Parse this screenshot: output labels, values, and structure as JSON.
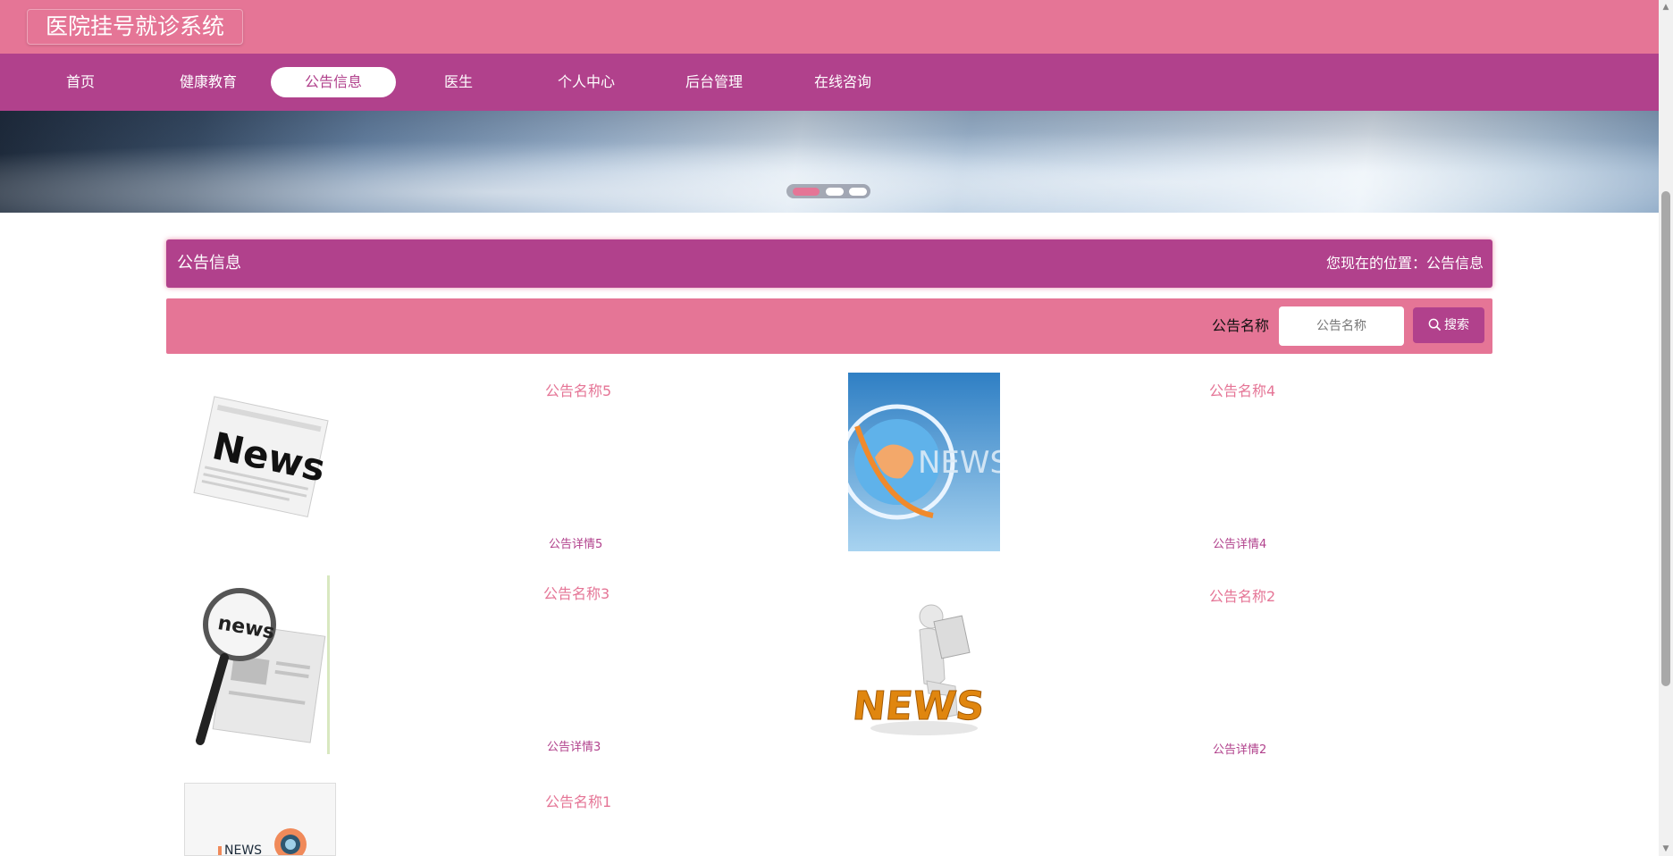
{
  "header": {
    "title": "医院挂号就诊系统"
  },
  "nav": {
    "items": [
      {
        "label": "首页"
      },
      {
        "label": "健康教育"
      },
      {
        "label": "公告信息"
      },
      {
        "label": "医生"
      },
      {
        "label": "个人中心"
      },
      {
        "label": "后台管理"
      },
      {
        "label": "在线咨询"
      }
    ],
    "active_index": 2
  },
  "banner": {
    "slide_count": 3,
    "active_slide": 1
  },
  "section": {
    "title": "公告信息",
    "breadcrumb": "您现在的位置：公告信息"
  },
  "search": {
    "label": "公告名称",
    "placeholder": "公告名称",
    "button_label": "搜索"
  },
  "notices": [
    {
      "name": "公告名称5",
      "detail": "公告详情5",
      "image": "newspaper-news-icon"
    },
    {
      "name": "公告名称4",
      "detail": "公告详情4",
      "image": "globe-news-icon"
    },
    {
      "name": "公告名称3",
      "detail": "公告详情3",
      "image": "magnifier-newspaper-icon"
    },
    {
      "name": "公告名称2",
      "detail": "公告详情2",
      "image": "figure-reading-news-icon"
    },
    {
      "name": "公告名称1",
      "detail": "",
      "image": "news-logo-icon"
    }
  ],
  "colors": {
    "pink": "#e57596",
    "purple": "#b1418c"
  }
}
